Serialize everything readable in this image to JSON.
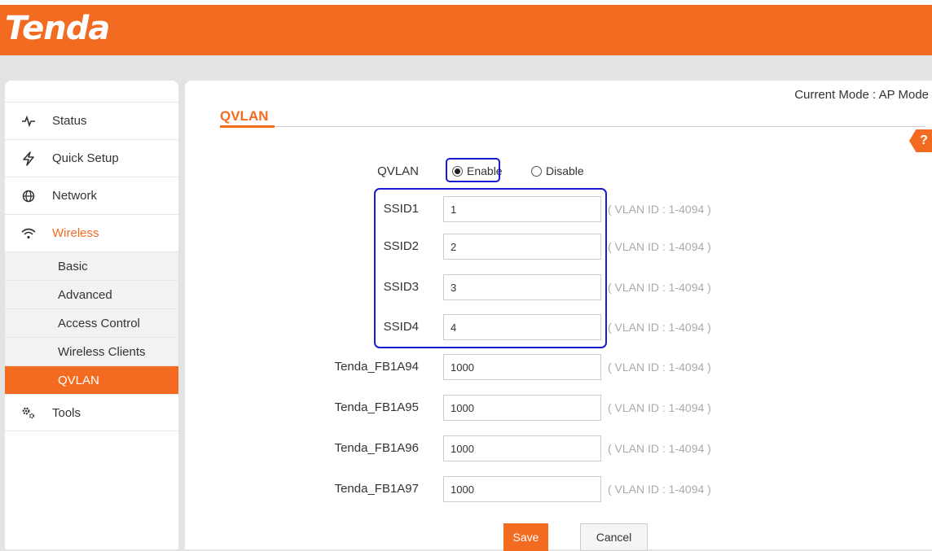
{
  "brand": {
    "logo_text": "Tenda",
    "accent_color": "#f26b21",
    "highlight_color": "#1b1bd6"
  },
  "sidebar": {
    "items": [
      {
        "label": "Status",
        "icon": "pulse-icon"
      },
      {
        "label": "Quick Setup",
        "icon": "lightning-icon"
      },
      {
        "label": "Network",
        "icon": "globe-icon"
      },
      {
        "label": "Wireless",
        "icon": "wifi-icon"
      },
      {
        "label": "Tools",
        "icon": "gears-icon"
      }
    ],
    "wireless_sub": [
      "Basic",
      "Advanced",
      "Access Control",
      "Wireless Clients",
      "QVLAN"
    ],
    "active_sub": "QVLAN"
  },
  "header": {
    "mode_text": "Current Mode : AP Mode",
    "help_label": "?"
  },
  "page": {
    "title": "QVLAN"
  },
  "qvlan": {
    "label": "QVLAN",
    "enable_label": "Enable",
    "disable_label": "Disable",
    "selected": "Enable"
  },
  "rows": [
    {
      "label": "SSID1",
      "value": "1",
      "hint": "( VLAN ID : 1-4094 )"
    },
    {
      "label": "SSID2",
      "value": "2",
      "hint": "( VLAN ID : 1-4094 )"
    },
    {
      "label": "SSID3",
      "value": "3",
      "hint": "( VLAN ID : 1-4094 )"
    },
    {
      "label": "SSID4",
      "value": "4",
      "hint": "( VLAN ID : 1-4094 )"
    },
    {
      "label": "Tenda_FB1A94",
      "value": "1000",
      "hint": "( VLAN ID : 1-4094 )"
    },
    {
      "label": "Tenda_FB1A95",
      "value": "1000",
      "hint": "( VLAN ID : 1-4094 )"
    },
    {
      "label": "Tenda_FB1A96",
      "value": "1000",
      "hint": "( VLAN ID : 1-4094 )"
    },
    {
      "label": "Tenda_FB1A97",
      "value": "1000",
      "hint": "( VLAN ID : 1-4094 )"
    }
  ],
  "buttons": {
    "save": "Save",
    "cancel": "Cancel"
  }
}
